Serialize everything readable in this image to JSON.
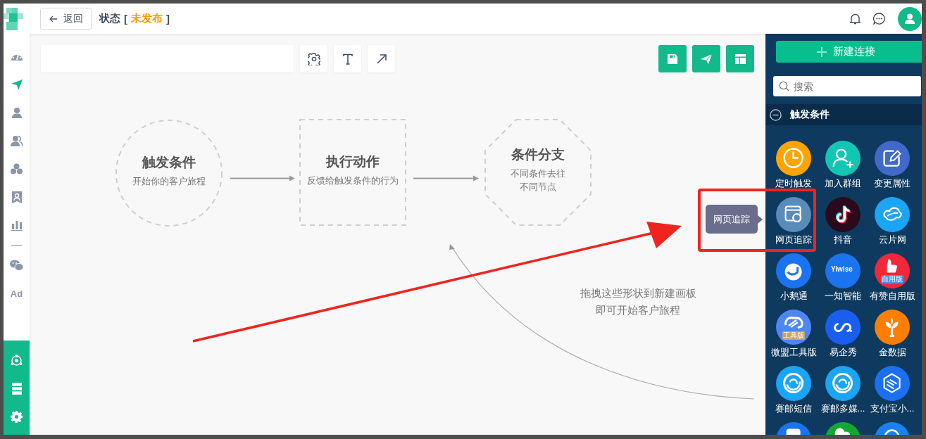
{
  "sidebar": {
    "items": [
      {
        "kind": "icon",
        "selected": false
      },
      {
        "kind": "icon",
        "selected": true
      },
      {
        "kind": "icon",
        "selected": false
      },
      {
        "kind": "icon",
        "selected": false
      },
      {
        "kind": "icon",
        "selected": false
      },
      {
        "kind": "icon",
        "selected": false
      },
      {
        "kind": "icon",
        "selected": false
      },
      {
        "kind": "divider"
      },
      {
        "kind": "icon",
        "selected": false
      },
      {
        "kind": "text",
        "label": "Ad",
        "selected": false
      }
    ]
  },
  "topbar": {
    "back_button": "返回",
    "title": "状态",
    "brackets": [
      "[",
      "]"
    ],
    "status": {
      "label": "未发布"
    }
  },
  "canvas": {
    "nodes": [
      {
        "kind": "circle",
        "title": "触发条件",
        "subtitle": "开始你的客户旅程"
      },
      {
        "kind": "square",
        "title": "执行动作",
        "subtitle": "反馈给触发条件的行为"
      },
      {
        "kind": "octagon",
        "title": "条件分支",
        "subtitle": "不同条件去往不同节点"
      }
    ],
    "hint": "拖拽这些形状到新建画板即可开始客户旅程"
  },
  "palette": {
    "new_button": "新建连接",
    "search": {
      "placeholder": "搜索"
    },
    "section": {
      "title": "触发条件",
      "expanded": true
    },
    "tooltip": "网页追踪",
    "items": [
      {
        "label": "定时触发",
        "color": "#ffa400"
      },
      {
        "label": "加入群组",
        "color": "#12c6b4"
      },
      {
        "label": "变更属性",
        "color": "#4169c9"
      },
      {
        "label": "网页追踪",
        "color": "#5a8bb9"
      },
      {
        "label": "抖音",
        "color": "#2b0a1c"
      },
      {
        "label": "云片网",
        "color": "#1aa5f5"
      },
      {
        "label": "小鹅通",
        "color": "#1a74f0"
      },
      {
        "label": "一知智能",
        "color": "#1a74f0",
        "badge": "Yiwise"
      },
      {
        "label": "有赞自用版",
        "color": "#f0283a",
        "badge": "自用版"
      },
      {
        "label": "微盟工具版",
        "color": "#4f86f6",
        "badge": "工具版"
      },
      {
        "label": "易企秀",
        "color": "#1a5ef0"
      },
      {
        "label": "金数据",
        "color": "#ff7e00"
      },
      {
        "label": "赛邮短信",
        "color": "#1aa5f5"
      },
      {
        "label": "赛邮多媒...",
        "color": "#1aa5f5"
      },
      {
        "label": "支付宝小...",
        "color": "#1a70f0"
      },
      {
        "color": "#1a74f0"
      },
      {
        "color": "#13a832"
      },
      {
        "color": "#1a82f0"
      }
    ]
  }
}
